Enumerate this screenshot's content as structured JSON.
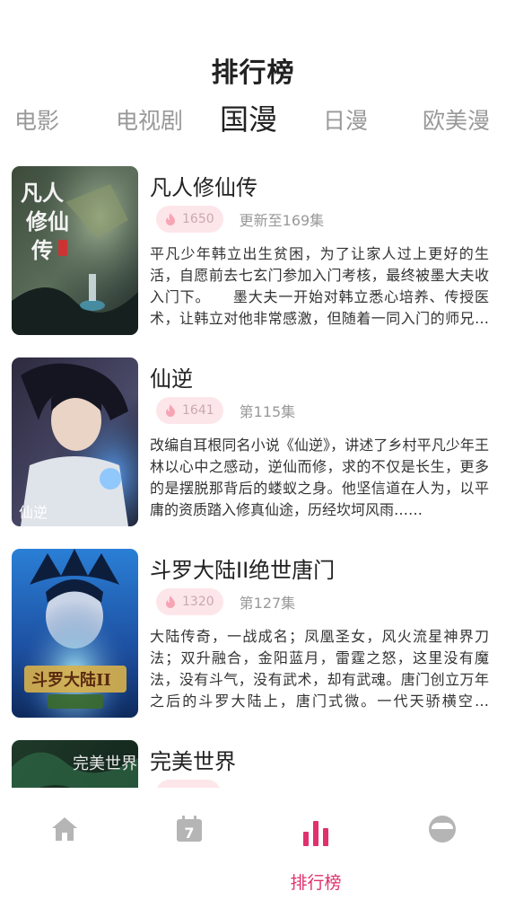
{
  "header": {
    "title": "排行榜"
  },
  "tabs": [
    {
      "label": "电影",
      "active": false
    },
    {
      "label": "电视剧",
      "active": false
    },
    {
      "label": "国漫",
      "active": true
    },
    {
      "label": "日漫",
      "active": false
    },
    {
      "label": "欧美漫",
      "active": false
    }
  ],
  "items": [
    {
      "title": "凡人修仙传",
      "heat": "1650",
      "episodes": "更新至169集",
      "description": "平凡少年韩立出生贫困，为了让家人过上更好的生活，自愿前去七玄门参加入门考核，最终被墨大夫收入门下。　　墨大夫一开始对韩立悉心培养、传授医术，让韩立对他非常感激，但随着一同入门的师兄们渐渐离开……",
      "cover_text": "凡人修仙传"
    },
    {
      "title": "仙逆",
      "heat": "1641",
      "episodes": "第115集",
      "description": "改编自耳根同名小说《仙逆》，讲述了乡村平凡少年王林以心中之感动，逆仙而修，求的不仅是长生，更多的是摆脱那背后的蝼蚁之身。他坚信道在人为，以平庸的资质踏入修真仙途，历经坎坷风雨……",
      "cover_text": "仙逆"
    },
    {
      "title": "斗罗大陆II绝世唐门",
      "heat": "1320",
      "episodes": "第127集",
      "description": "大陆传奇，一战成名；凤凰圣女，风火流星神界刀法；双升融合，金阳蓝月，雷霆之怒，这里没有魔法，没有斗气，没有武术，却有武魂。唐门创立万年之后的斗罗大陆上，唐门式微。一代天骄横空出世……",
      "cover_text": "斗罗大陆II"
    },
    {
      "title": "完美世界",
      "heat": "",
      "episodes": "",
      "description": "",
      "cover_text": "完美世界"
    }
  ],
  "bottom_nav": [
    {
      "icon": "home-icon",
      "label": "",
      "active": false
    },
    {
      "icon": "calendar-icon",
      "label": "",
      "calendar_day": "7",
      "active": false
    },
    {
      "icon": "ranking-icon",
      "label": "排行榜",
      "active": true
    },
    {
      "icon": "profile-icon",
      "label": "",
      "active": false
    }
  ],
  "colors": {
    "accent": "#e0306d",
    "badge_bg": "#fde6ea",
    "inactive_icon": "#b5b5b5"
  }
}
